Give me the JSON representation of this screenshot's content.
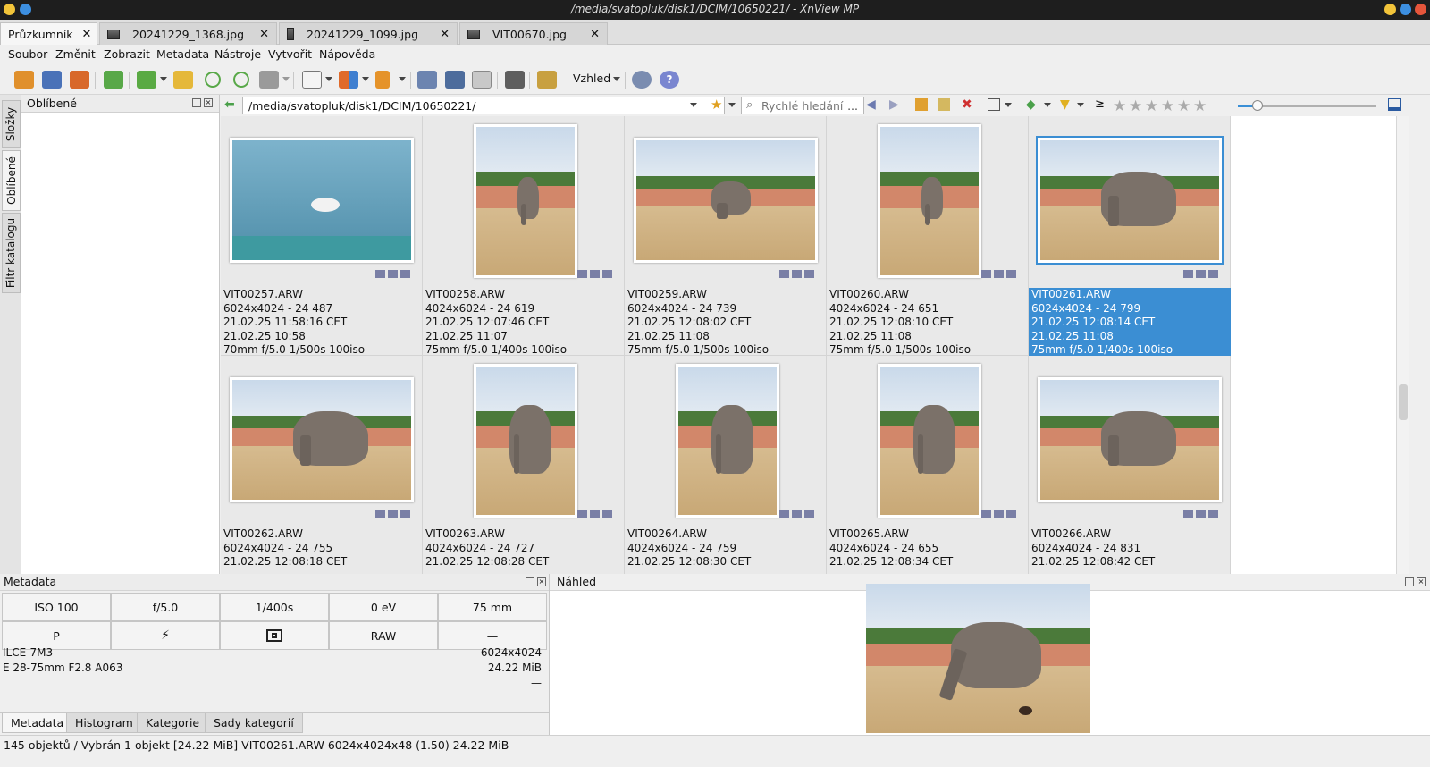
{
  "window": {
    "title": "/media/svatopluk/disk1/DCIM/10650221/ - XnView MP"
  },
  "colors": {
    "accent": "#3b8ed3",
    "titlebar": "#1e1e1e"
  },
  "tabs": [
    {
      "label": "Průzkumník",
      "active": true
    },
    {
      "label": "20241229_1368.jpg"
    },
    {
      "label": "20241229_1099.jpg"
    },
    {
      "label": "VIT00670.jpg"
    }
  ],
  "menu": [
    "Soubor",
    "Změnit",
    "Zobrazit",
    "Metadata",
    "Nástroje",
    "Vytvořit",
    "Nápověda"
  ],
  "toolbar": {
    "view_label": "Vzhled"
  },
  "sidetabs": [
    "Složky",
    "Oblíbené",
    "Filtr katalogu"
  ],
  "favorites": {
    "title": "Oblíbené"
  },
  "address": {
    "path": "/media/svatopluk/disk1/DCIM/10650221/",
    "search_placeholder": "Rychlé hledání",
    "search_more": "...",
    "ge_symbol": "≥"
  },
  "thumbnails": [
    {
      "name": "VIT00257.ARW",
      "dims": "6024x4024 - 24 487",
      "date": "21.02.25 11:58:16 CET",
      "date2": "21.02.25 10:58",
      "exif": "70mm f/5.0 1/500s 100iso",
      "scene": "water",
      "orient": "landscape"
    },
    {
      "name": "VIT00258.ARW",
      "dims": "4024x6024 - 24 619",
      "date": "21.02.25 12:07:46 CET",
      "date2": "21.02.25 11:07",
      "exif": "75mm f/5.0 1/400s 100iso",
      "scene": "zoo",
      "orient": "portrait"
    },
    {
      "name": "VIT00259.ARW",
      "dims": "6024x4024 - 24 739",
      "date": "21.02.25 12:08:02 CET",
      "date2": "21.02.25 11:08",
      "exif": "75mm f/5.0 1/500s 100iso",
      "scene": "zoo",
      "orient": "landscape"
    },
    {
      "name": "VIT00260.ARW",
      "dims": "4024x6024 - 24 651",
      "date": "21.02.25 12:08:10 CET",
      "date2": "21.02.25 11:08",
      "exif": "75mm f/5.0 1/500s 100iso",
      "scene": "zoo",
      "orient": "portrait"
    },
    {
      "name": "VIT00261.ARW",
      "dims": "6024x4024 - 24 799",
      "date": "21.02.25 12:08:14 CET",
      "date2": "21.02.25 11:08",
      "exif": "75mm f/5.0 1/400s 100iso",
      "scene": "zoo",
      "orient": "landscape",
      "selected": true
    },
    {
      "name": "VIT00262.ARW",
      "dims": "6024x4024 - 24 755",
      "date": "21.02.25 12:08:18 CET",
      "scene": "zoo",
      "orient": "landscape"
    },
    {
      "name": "VIT00263.ARW",
      "dims": "4024x6024 - 24 727",
      "date": "21.02.25 12:08:28 CET",
      "scene": "zoo",
      "orient": "portrait"
    },
    {
      "name": "VIT00264.ARW",
      "dims": "4024x6024 - 24 759",
      "date": "21.02.25 12:08:30 CET",
      "scene": "zoo",
      "orient": "portrait"
    },
    {
      "name": "VIT00265.ARW",
      "dims": "4024x6024 - 24 655",
      "date": "21.02.25 12:08:34 CET",
      "scene": "zoo",
      "orient": "portrait"
    },
    {
      "name": "VIT00266.ARW",
      "dims": "6024x4024 - 24 831",
      "date": "21.02.25 12:08:42 CET",
      "scene": "zoo",
      "orient": "landscape"
    }
  ],
  "metadata": {
    "title": "Metadata",
    "iso": "ISO 100",
    "aperture": "f/5.0",
    "shutter": "1/400s",
    "ev": "0 eV",
    "focal": "75 mm",
    "mode": "P",
    "flash_icon": "flash-off-icon",
    "metering_icon": "metering-multi-icon",
    "format": "RAW",
    "dash": "—",
    "camera": "ILCE-7M3",
    "lens": "E 28-75mm F2.8 A063",
    "resolution": "6024x4024",
    "size": "24.22 MiB",
    "extra": "—",
    "tabs": [
      "Metadata",
      "Histogram",
      "Kategorie",
      "Sady kategorií"
    ]
  },
  "preview": {
    "title": "Náhled"
  },
  "status": {
    "text": "145 objektů / Vybrán 1 objekt [24.22 MiB]  VIT00261.ARW  6024x4024x48 (1.50)  24.22 MiB"
  }
}
